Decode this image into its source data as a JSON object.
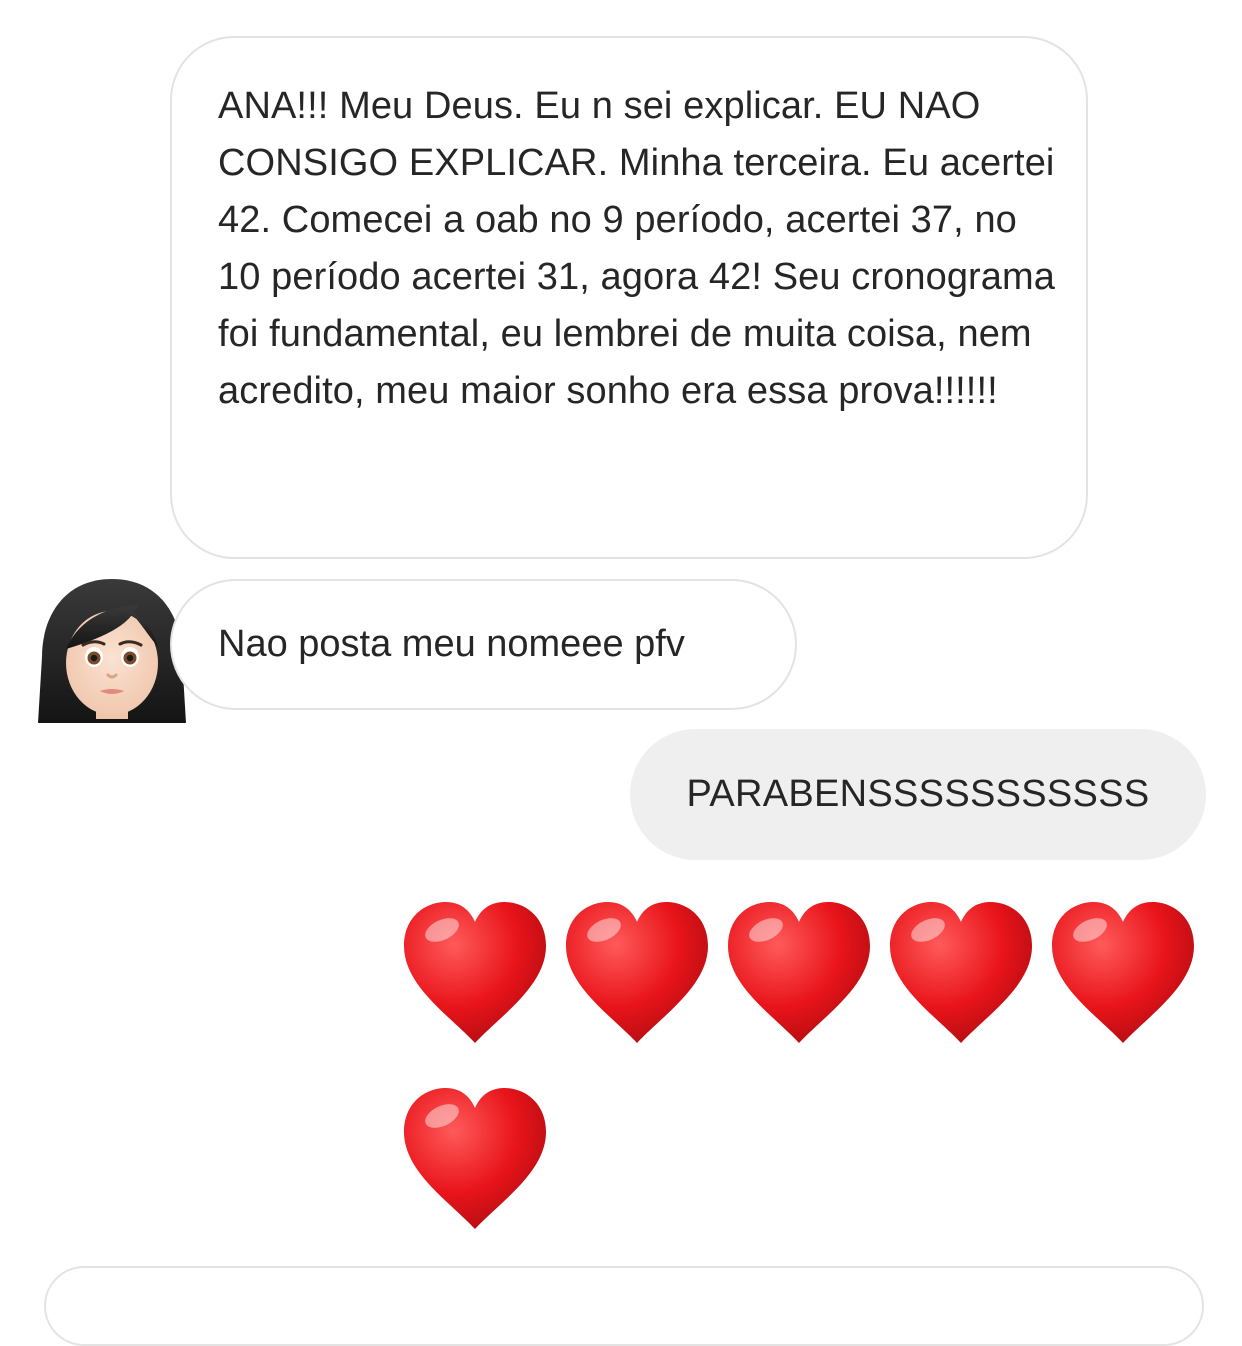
{
  "conversation": {
    "messages": [
      {
        "direction": "incoming",
        "text": "ANA!!! Meu Deus. Eu n sei explicar. EU NAO CONSIGO EXPLICAR. Minha terceira. Eu acertei 42. Comecei a oab no 9 período, acertei 37, no 10 período acertei 31, agora 42! Seu cronograma foi fundamental, eu lembrei de muita coisa, nem acredito, meu maior sonho era essa prova!!!!!!"
      },
      {
        "direction": "incoming",
        "text": "Nao posta meu nomeee pfv",
        "avatar_icon": "woman-emoji-avatar-icon"
      },
      {
        "direction": "outgoing",
        "text": "PARABENSSSSSSSSSSS"
      },
      {
        "direction": "outgoing",
        "emoji_icon": "red-heart-icon",
        "emoji_count": 6
      }
    ]
  },
  "colors": {
    "incoming_border": "#e3e3e3",
    "outgoing_background": "#efefef",
    "text": "#262626",
    "heart": "#e3161c"
  }
}
